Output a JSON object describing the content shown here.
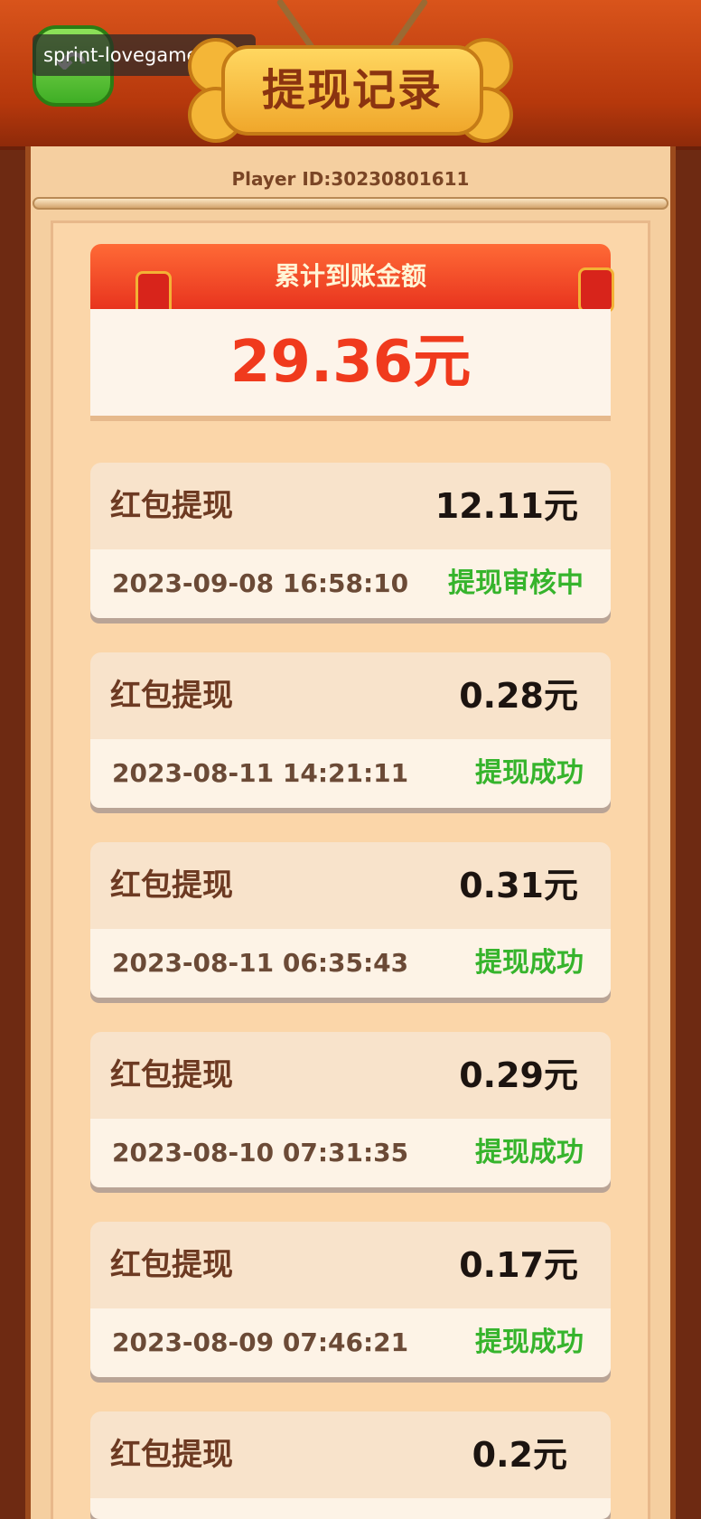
{
  "header": {
    "title": "提现记录",
    "back_icon": "back-arrow-icon",
    "watermark": "sprint-lovegame.com"
  },
  "player": {
    "id_text": "Player ID:30230801611"
  },
  "summary": {
    "label": "累计到账金额",
    "total": "29.36元"
  },
  "records": [
    {
      "label": "红包提现",
      "amount": "12.11元",
      "time": "2023-09-08 16:58:10",
      "status": "提现审核中"
    },
    {
      "label": "红包提现",
      "amount": "0.28元",
      "time": "2023-08-11 14:21:11",
      "status": "提现成功"
    },
    {
      "label": "红包提现",
      "amount": "0.31元",
      "time": "2023-08-11 06:35:43",
      "status": "提现成功"
    },
    {
      "label": "红包提现",
      "amount": "0.29元",
      "time": "2023-08-10 07:31:35",
      "status": "提现成功"
    },
    {
      "label": "红包提现",
      "amount": "0.17元",
      "time": "2023-08-09 07:46:21",
      "status": "提现成功"
    },
    {
      "label": "红包提现",
      "amount": "0.2元"
    }
  ],
  "colors": {
    "status_green": "#36b42c",
    "total_red": "#f03a1d",
    "header_orange": "#d9541b"
  }
}
